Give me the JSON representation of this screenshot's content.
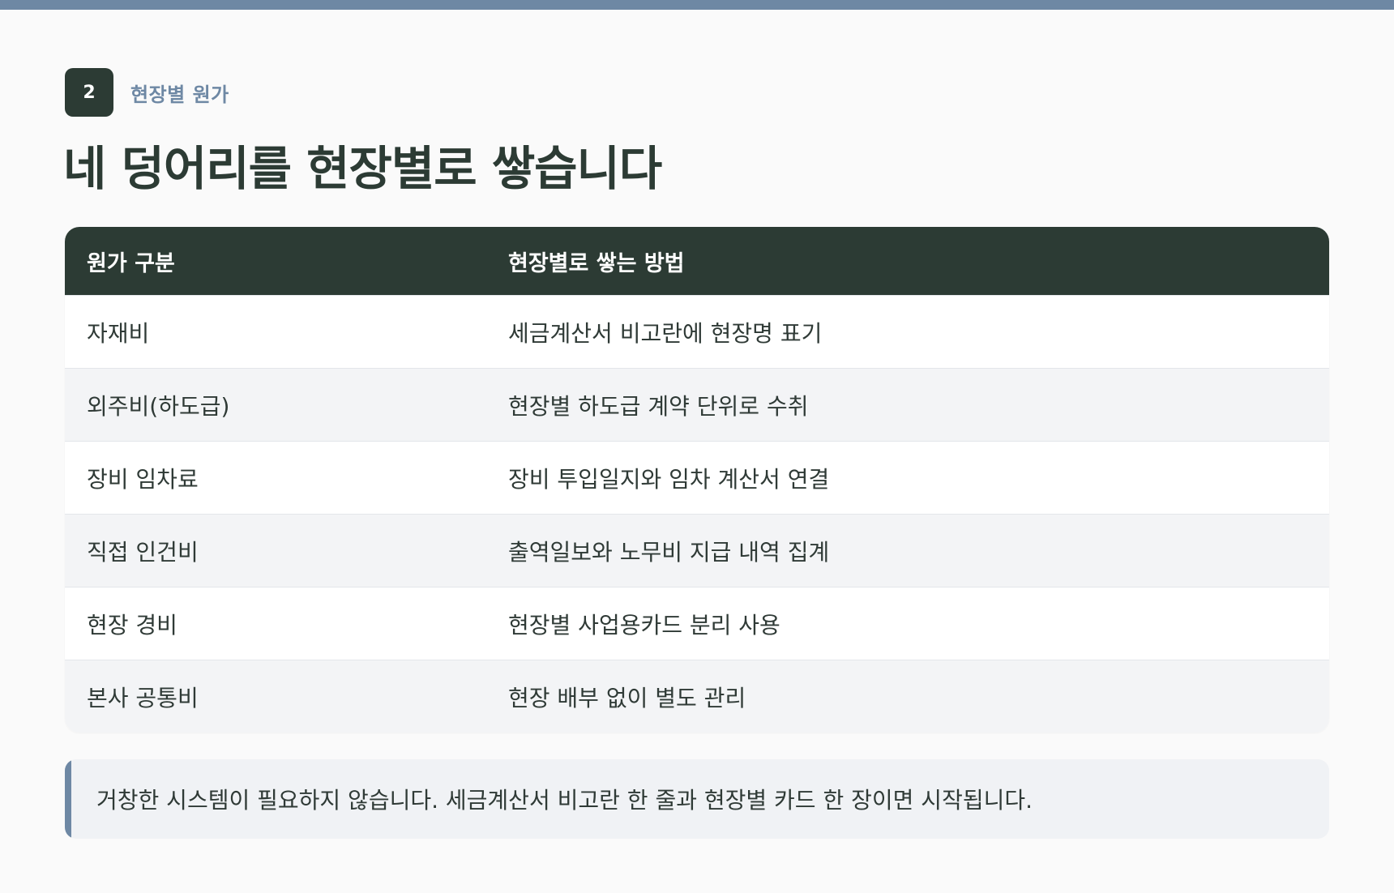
{
  "section": {
    "number": "2",
    "label": "현장별 원가"
  },
  "title": "네 덩어리를 현장별로 쌓습니다",
  "table": {
    "headers": [
      "원가 구분",
      "현장별로 쌓는 방법"
    ],
    "rows": [
      [
        "자재비",
        "세금계산서 비고란에 현장명 표기"
      ],
      [
        "외주비(하도급)",
        "현장별 하도급 계약 단위로 수취"
      ],
      [
        "장비 임차료",
        "장비 투입일지와 임차 계산서 연결"
      ],
      [
        "직접 인건비",
        "출역일보와 노무비 지급 내역 집계"
      ],
      [
        "현장 경비",
        "현장별 사업용카드 분리 사용"
      ],
      [
        "본사 공통비",
        "현장 배부 없이 별도 관리"
      ]
    ]
  },
  "callout": {
    "text": "거창한 시스템이 필요하지 않습니다. 세금계산서 비고란 한 줄과 현장별 카드 한 장이면 시작됩니다."
  },
  "colors": {
    "accent": "#6e88a4",
    "dark": "#2c3b34",
    "row_alt": "#f3f4f6",
    "background": "#fafafa"
  }
}
